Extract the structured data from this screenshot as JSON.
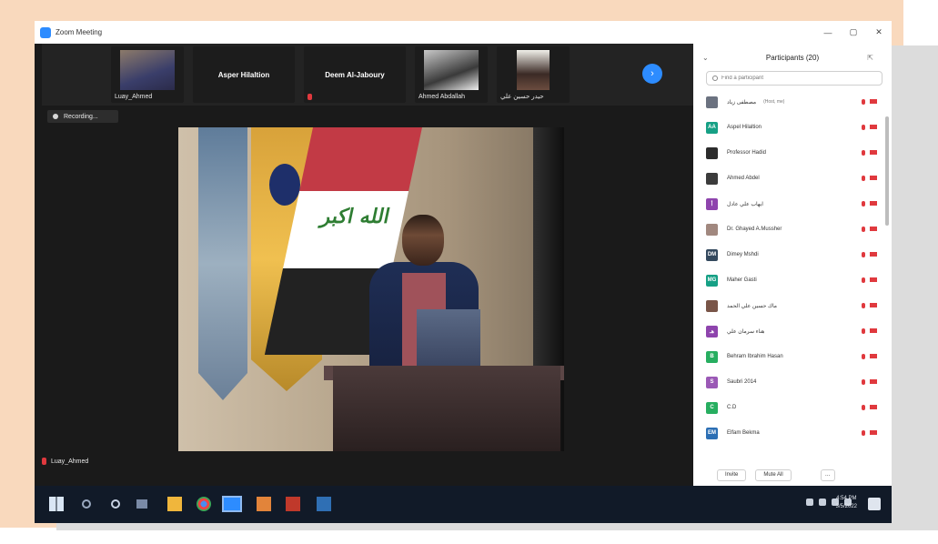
{
  "window": {
    "title": "Zoom Meeting"
  },
  "window_controls": {
    "minimize": "—",
    "maximize": "▢",
    "close": "✕"
  },
  "gallery": {
    "tiles": [
      {
        "name": "Luay_Ahmed"
      },
      {
        "name": "Asper Hilaltion"
      },
      {
        "name": "Deem Al-Jaboury"
      },
      {
        "name": "Ahmed Abdallah"
      },
      {
        "name": "حيدر حسين علي"
      }
    ],
    "next_label": "›"
  },
  "recording": {
    "label": "Recording..."
  },
  "speaker": {
    "name": "Luay_Ahmed"
  },
  "flag_text": "الله اكبر",
  "participants": {
    "title": "Participants (20)",
    "collapse": "⌄",
    "popout": "⇱",
    "search_placeholder": "Find a participant",
    "list": [
      {
        "initials": "",
        "name": "مصطفى زياد",
        "tag": "(Host, me)",
        "color": "#6b7280"
      },
      {
        "initials": "AA",
        "name": "Aspel Hilaltion",
        "tag": "",
        "color": "#16a085"
      },
      {
        "initials": "",
        "name": "Professor Hadid",
        "tag": "",
        "color": "#2c2c2c"
      },
      {
        "initials": "",
        "name": "Ahmed Abdel",
        "tag": "",
        "color": "#3b3b3b"
      },
      {
        "initials": "أ",
        "name": "ايهاب علي عادل",
        "tag": "",
        "color": "#8e44ad"
      },
      {
        "initials": "",
        "name": "Dr. Ghayed A.Mussher",
        "tag": "",
        "color": "#a1887f"
      },
      {
        "initials": "DM",
        "name": "Dimey Mshdi",
        "tag": "",
        "color": "#34495e"
      },
      {
        "initials": "MG",
        "name": "Maher Gasti",
        "tag": "",
        "color": "#16a085"
      },
      {
        "initials": "",
        "name": "ماك حسين علي الحمد",
        "tag": "",
        "color": "#795548"
      },
      {
        "initials": "هـ",
        "name": "هناء سرمان علي",
        "tag": "",
        "color": "#8e44ad"
      },
      {
        "initials": "B",
        "name": "Behram Ibrahim Hasan",
        "tag": "",
        "color": "#27ae60"
      },
      {
        "initials": "S",
        "name": "Saubri 2014",
        "tag": "",
        "color": "#9b59b6"
      },
      {
        "initials": "C",
        "name": "C.D",
        "tag": "",
        "color": "#27ae60"
      },
      {
        "initials": "EM",
        "name": "Elfam Bekma",
        "tag": "",
        "color": "#2c6fb4"
      }
    ],
    "footer": {
      "invite": "Invite",
      "mute_all": "Mute All",
      "more": "…"
    }
  },
  "taskbar": {
    "clock_time": "4:54 PM",
    "clock_date": "3/5/2022"
  },
  "colors": {
    "accent": "#2d8cff",
    "muted_red": "#e0393e",
    "frame_peach": "#f9d9bd",
    "frame_gray": "#dcdcdc"
  }
}
